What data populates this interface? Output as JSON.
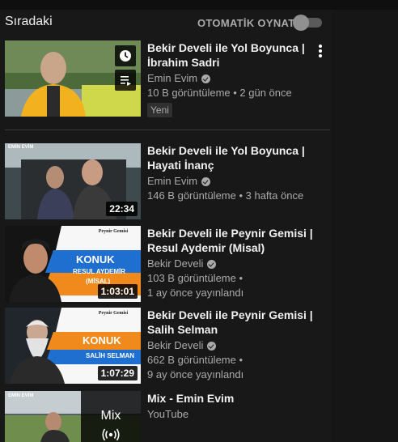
{
  "header": {
    "title": "Sıradaki",
    "autoplay_label": "OTOMATİK OYNAT",
    "autoplay_on": false
  },
  "videos": [
    {
      "title": "Bekir Develi ile Yol Boyunca | İbrahim Sadri",
      "channel": "Emin Evim",
      "verified": true,
      "stats": "10 B görüntüleme • 2 gün önce",
      "badge": "Yeni",
      "thumb_icons": [
        "clock-icon",
        "queue-icon"
      ]
    },
    {
      "title": "Bekir Develi ile Yol Boyunca | Hayati İnanç",
      "channel": "Emin Evim",
      "verified": true,
      "stats": "146 B görüntüleme • 3 hafta önce",
      "duration": "22:34",
      "thumb_text": "EMİN EVİM"
    },
    {
      "title": "Bekir Develi ile Peynir Gemisi | Resul Aydemir (Misal)",
      "channel": "Bekir Develi",
      "verified": true,
      "stats_line1": "103 B görüntüleme •",
      "stats_line2": "1 ay önce yayınlandı",
      "duration": "1:03:01",
      "thumb_text": {
        "logo": "Peynir Gemisi",
        "guest_label": "KONUK",
        "guest_name": "RESUL AYDEMİR",
        "guest_sub": "(MİSAL)"
      }
    },
    {
      "title": "Bekir Develi ile Peynir Gemisi | Salih Selman",
      "channel": "Bekir Develi",
      "verified": true,
      "stats_line1": "662 B görüntüleme •",
      "stats_line2": "9 ay önce yayınlandı",
      "duration": "1:07:29",
      "thumb_text": {
        "logo": "Peynir Gemisi",
        "guest_label": "KONUK",
        "guest_name": "SALİH SELMAN"
      }
    },
    {
      "title": "Mix - Emin Evim",
      "channel": "YouTube",
      "mix_label": "Mix",
      "thumb_text": "EMİN EVİM",
      "thumb_icons": [
        "radio-icon"
      ]
    }
  ],
  "colors": {
    "background": "#181818",
    "text_primary": "#f1f1f1",
    "text_secondary": "#aaaaaa",
    "konuk_blue": "#1e6fd0",
    "konuk_orange": "#f08a1c"
  }
}
